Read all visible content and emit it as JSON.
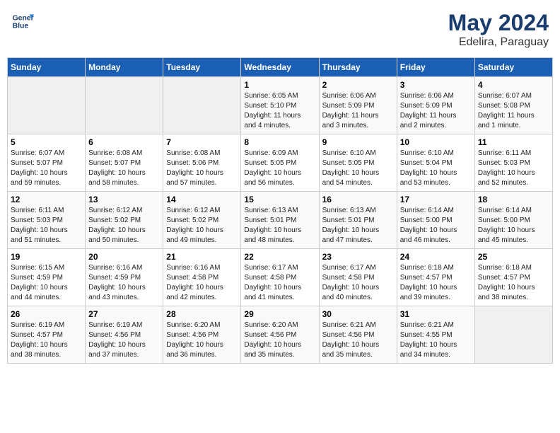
{
  "header": {
    "logo_line1": "General",
    "logo_line2": "Blue",
    "title": "May 2024",
    "subtitle": "Edelira, Paraguay"
  },
  "calendar": {
    "weekdays": [
      "Sunday",
      "Monday",
      "Tuesday",
      "Wednesday",
      "Thursday",
      "Friday",
      "Saturday"
    ],
    "weeks": [
      [
        {
          "day": "",
          "info": ""
        },
        {
          "day": "",
          "info": ""
        },
        {
          "day": "",
          "info": ""
        },
        {
          "day": "1",
          "info": "Sunrise: 6:05 AM\nSunset: 5:10 PM\nDaylight: 11 hours\nand 4 minutes."
        },
        {
          "day": "2",
          "info": "Sunrise: 6:06 AM\nSunset: 5:09 PM\nDaylight: 11 hours\nand 3 minutes."
        },
        {
          "day": "3",
          "info": "Sunrise: 6:06 AM\nSunset: 5:09 PM\nDaylight: 11 hours\nand 2 minutes."
        },
        {
          "day": "4",
          "info": "Sunrise: 6:07 AM\nSunset: 5:08 PM\nDaylight: 11 hours\nand 1 minute."
        }
      ],
      [
        {
          "day": "5",
          "info": "Sunrise: 6:07 AM\nSunset: 5:07 PM\nDaylight: 10 hours\nand 59 minutes."
        },
        {
          "day": "6",
          "info": "Sunrise: 6:08 AM\nSunset: 5:07 PM\nDaylight: 10 hours\nand 58 minutes."
        },
        {
          "day": "7",
          "info": "Sunrise: 6:08 AM\nSunset: 5:06 PM\nDaylight: 10 hours\nand 57 minutes."
        },
        {
          "day": "8",
          "info": "Sunrise: 6:09 AM\nSunset: 5:05 PM\nDaylight: 10 hours\nand 56 minutes."
        },
        {
          "day": "9",
          "info": "Sunrise: 6:10 AM\nSunset: 5:05 PM\nDaylight: 10 hours\nand 54 minutes."
        },
        {
          "day": "10",
          "info": "Sunrise: 6:10 AM\nSunset: 5:04 PM\nDaylight: 10 hours\nand 53 minutes."
        },
        {
          "day": "11",
          "info": "Sunrise: 6:11 AM\nSunset: 5:03 PM\nDaylight: 10 hours\nand 52 minutes."
        }
      ],
      [
        {
          "day": "12",
          "info": "Sunrise: 6:11 AM\nSunset: 5:03 PM\nDaylight: 10 hours\nand 51 minutes."
        },
        {
          "day": "13",
          "info": "Sunrise: 6:12 AM\nSunset: 5:02 PM\nDaylight: 10 hours\nand 50 minutes."
        },
        {
          "day": "14",
          "info": "Sunrise: 6:12 AM\nSunset: 5:02 PM\nDaylight: 10 hours\nand 49 minutes."
        },
        {
          "day": "15",
          "info": "Sunrise: 6:13 AM\nSunset: 5:01 PM\nDaylight: 10 hours\nand 48 minutes."
        },
        {
          "day": "16",
          "info": "Sunrise: 6:13 AM\nSunset: 5:01 PM\nDaylight: 10 hours\nand 47 minutes."
        },
        {
          "day": "17",
          "info": "Sunrise: 6:14 AM\nSunset: 5:00 PM\nDaylight: 10 hours\nand 46 minutes."
        },
        {
          "day": "18",
          "info": "Sunrise: 6:14 AM\nSunset: 5:00 PM\nDaylight: 10 hours\nand 45 minutes."
        }
      ],
      [
        {
          "day": "19",
          "info": "Sunrise: 6:15 AM\nSunset: 4:59 PM\nDaylight: 10 hours\nand 44 minutes."
        },
        {
          "day": "20",
          "info": "Sunrise: 6:16 AM\nSunset: 4:59 PM\nDaylight: 10 hours\nand 43 minutes."
        },
        {
          "day": "21",
          "info": "Sunrise: 6:16 AM\nSunset: 4:58 PM\nDaylight: 10 hours\nand 42 minutes."
        },
        {
          "day": "22",
          "info": "Sunrise: 6:17 AM\nSunset: 4:58 PM\nDaylight: 10 hours\nand 41 minutes."
        },
        {
          "day": "23",
          "info": "Sunrise: 6:17 AM\nSunset: 4:58 PM\nDaylight: 10 hours\nand 40 minutes."
        },
        {
          "day": "24",
          "info": "Sunrise: 6:18 AM\nSunset: 4:57 PM\nDaylight: 10 hours\nand 39 minutes."
        },
        {
          "day": "25",
          "info": "Sunrise: 6:18 AM\nSunset: 4:57 PM\nDaylight: 10 hours\nand 38 minutes."
        }
      ],
      [
        {
          "day": "26",
          "info": "Sunrise: 6:19 AM\nSunset: 4:57 PM\nDaylight: 10 hours\nand 38 minutes."
        },
        {
          "day": "27",
          "info": "Sunrise: 6:19 AM\nSunset: 4:56 PM\nDaylight: 10 hours\nand 37 minutes."
        },
        {
          "day": "28",
          "info": "Sunrise: 6:20 AM\nSunset: 4:56 PM\nDaylight: 10 hours\nand 36 minutes."
        },
        {
          "day": "29",
          "info": "Sunrise: 6:20 AM\nSunset: 4:56 PM\nDaylight: 10 hours\nand 35 minutes."
        },
        {
          "day": "30",
          "info": "Sunrise: 6:21 AM\nSunset: 4:56 PM\nDaylight: 10 hours\nand 35 minutes."
        },
        {
          "day": "31",
          "info": "Sunrise: 6:21 AM\nSunset: 4:55 PM\nDaylight: 10 hours\nand 34 minutes."
        },
        {
          "day": "",
          "info": ""
        }
      ]
    ]
  }
}
